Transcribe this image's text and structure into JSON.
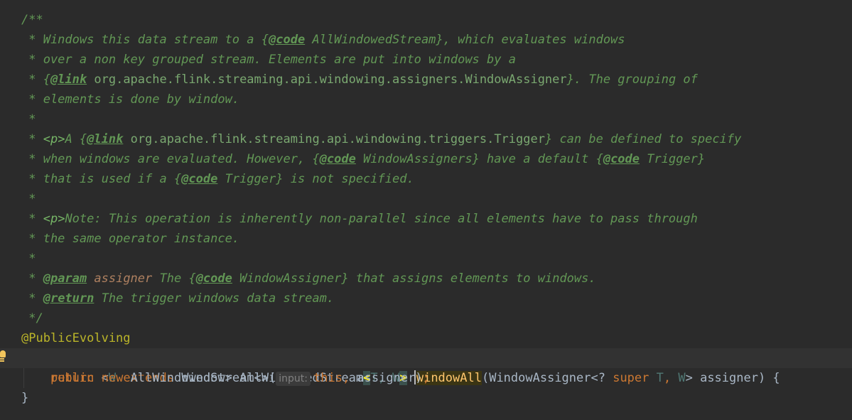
{
  "code": {
    "line1": "/**",
    "line2": {
      "a": " * Windows this data stream to a {",
      "tag": "@code",
      "b": " AllWindowedStream}, which evaluates windows"
    },
    "line3": " * over a non key grouped stream. Elements are put into windows by a",
    "line4": {
      "a": " * {",
      "tag": "@link",
      "ref": " org.apache.flink.streaming.api.windowing.assigners.WindowAssigner",
      "b": "}. The grouping of"
    },
    "line5": " * elements is done by window.",
    "line6": " *",
    "line7": {
      "a": " * ",
      "p": "<p>",
      "b": "A {",
      "tag": "@link",
      "ref": " org.apache.flink.streaming.api.windowing.triggers.Trigger",
      "c": "} can be defined to specify"
    },
    "line8": {
      "a": " * when windows are evaluated. However, {",
      "tag1": "@code",
      "b": " WindowAssigners} have a default {",
      "tag2": "@code",
      "c": " Trigger}"
    },
    "line9": {
      "a": " * that is used if a {",
      "tag": "@code",
      "b": " Trigger} is not specified."
    },
    "line10": " *",
    "line11": {
      "a": " * ",
      "p": "<p>",
      "b": "Note: This operation is inherently non-parallel since all elements have to pass through"
    },
    "line12": " * the same operator instance.",
    "line13": " *",
    "line14": {
      "a": " * ",
      "tag": "@param",
      "pname": " assigner",
      "b": " The {",
      "tag2": "@code",
      "c": " WindowAssigner} that assigns elements to windows."
    },
    "line15": {
      "a": " * ",
      "tag": "@return",
      "b": " The trigger windows data stream."
    },
    "line16": " */",
    "line17": "@PublicEvolving",
    "line18": {
      "kw_public": "public",
      "lt": " <",
      "tp_w": "W",
      "kw_extends": " extends",
      "window": " Window> AllWindowedStream",
      "br_open": "<",
      "tp_t": "T",
      "comma": ", ",
      "tp_w2": "W",
      "br_close": ">",
      "space": " ",
      "method": "windowAll",
      "params_a": "(WindowAssigner<? ",
      "kw_super": "super",
      "tp_t2": " T",
      "comma2": ", ",
      "tp_w3": "W",
      "params_b": "> assigner) {"
    },
    "line19": {
      "indent": "    ",
      "kw_return": "return",
      "kw_new": " new",
      "cls": " AllWindowedStream<>(",
      "hint": "input:",
      "kw_this": "this,",
      "rest": " assigner)",
      "semi": ";"
    },
    "line20": "}"
  },
  "gutter": {
    "intention_icon": "lightbulb-icon"
  }
}
